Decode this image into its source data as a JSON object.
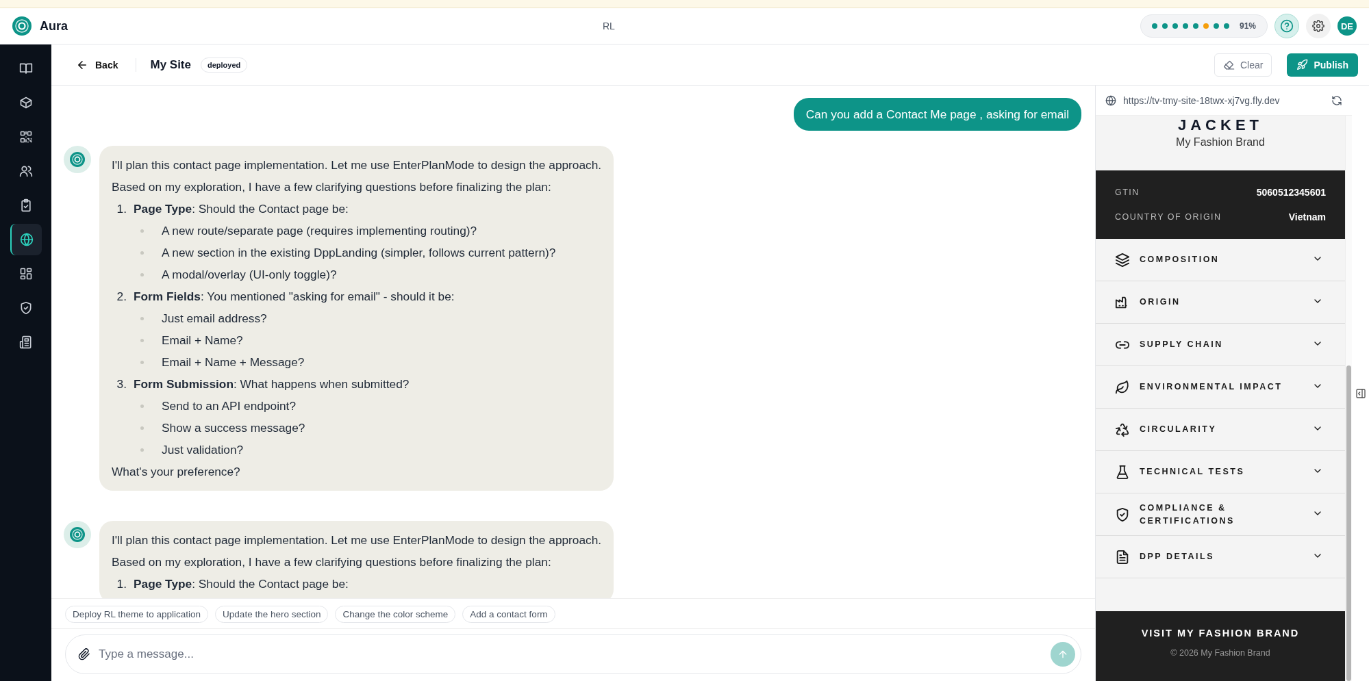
{
  "app": {
    "name": "Aura",
    "workspace": "RL"
  },
  "status": {
    "dots": [
      {
        "color": "#0d9488"
      },
      {
        "color": "#0d9488"
      },
      {
        "color": "#0d9488"
      },
      {
        "color": "#0d9488"
      },
      {
        "color": "#0d9488"
      },
      {
        "color": "#f59e0b"
      },
      {
        "color": "#0d9488"
      },
      {
        "color": "#0d9488"
      }
    ],
    "percent": "91%"
  },
  "user": {
    "initials": "DE"
  },
  "sidebar": {
    "items": [
      {
        "selected": false
      },
      {
        "selected": false
      },
      {
        "selected": false
      },
      {
        "selected": false
      },
      {
        "selected": false
      },
      {
        "selected": true
      },
      {
        "selected": false
      },
      {
        "selected": false
      },
      {
        "selected": false
      }
    ]
  },
  "toolbar": {
    "back": "Back",
    "title": "My Site",
    "badge": "deployed",
    "clear": "Clear",
    "publish": "Publish"
  },
  "messages": [
    {
      "kind": "user",
      "blocks": [
        {
          "kind": "paragraph",
          "text": "Can you add a Contact Me page , asking for email"
        }
      ]
    },
    {
      "kind": "assistant",
      "blocks": [
        {
          "kind": "paragraph",
          "text": "I'll plan this contact page implementation. Let me use EnterPlanMode to design the approach."
        },
        {
          "kind": "paragraph",
          "text": "Based on my exploration, I have a few clarifying questions before finalizing the plan:"
        },
        {
          "kind": "list",
          "items": [
            {
              "number": "1.",
              "text": "**Page Type**: Should the Contact page be:",
              "children": [
                "A new route/separate page (requires implementing routing)?",
                "A new section in the existing DppLanding (simpler, follows current pattern)?",
                "A modal/overlay (UI-only toggle)?"
              ]
            },
            {
              "number": "2.",
              "text": "**Form Fields**: You mentioned \"asking for email\" - should it be:",
              "children": [
                "Just email address?",
                "Email + Name?",
                "Email + Name + Message?"
              ]
            },
            {
              "number": "3.",
              "text": "**Form Submission**: What happens when submitted?",
              "children": [
                "Send to an API endpoint?",
                "Show a success message?",
                "Just validation?"
              ]
            }
          ]
        },
        {
          "kind": "paragraph",
          "text": "What's your preference?"
        }
      ]
    },
    {
      "kind": "assistant",
      "blocks": [
        {
          "kind": "paragraph",
          "text": "I'll plan this contact page implementation. Let me use EnterPlanMode to design the approach."
        },
        {
          "kind": "paragraph",
          "text": "Based on my exploration, I have a few clarifying questions before finalizing the plan:"
        },
        {
          "kind": "list",
          "items": [
            {
              "number": "1.",
              "text": "**Page Type**: Should the Contact page be:"
            }
          ]
        }
      ]
    }
  ],
  "suggestions": [
    "Deploy RL theme to application",
    "Update the hero section",
    "Change the color scheme",
    "Add a contact form"
  ],
  "composer": {
    "placeholder": "Type a message...",
    "send_disabled": true
  },
  "preview": {
    "url": "https://tv-tmy-site-18twx-xj7vg.fly.dev",
    "product": "JACKET",
    "brand": "My Fashion Brand",
    "facts": [
      {
        "label": "GTIN",
        "value": "5060512345601"
      },
      {
        "label": "COUNTRY OF ORIGIN",
        "value": "Vietnam"
      }
    ],
    "sections": [
      {
        "title": "COMPOSITION",
        "expanded": false
      },
      {
        "title": "ORIGIN",
        "expanded": false
      },
      {
        "title": "SUPPLY CHAIN",
        "expanded": false
      },
      {
        "title": "ENVIRONMENTAL IMPACT",
        "expanded": false
      },
      {
        "title": "CIRCULARITY",
        "expanded": false
      },
      {
        "title": "TECHNICAL TESTS",
        "expanded": false
      },
      {
        "title": "COMPLIANCE & CERTIFICATIONS",
        "expanded": false
      },
      {
        "title": "DPP DETAILS",
        "expanded": false
      }
    ],
    "footer_link": "VISIT MY FASHION BRAND",
    "copyright": "© 2026 My Fashion Brand"
  }
}
